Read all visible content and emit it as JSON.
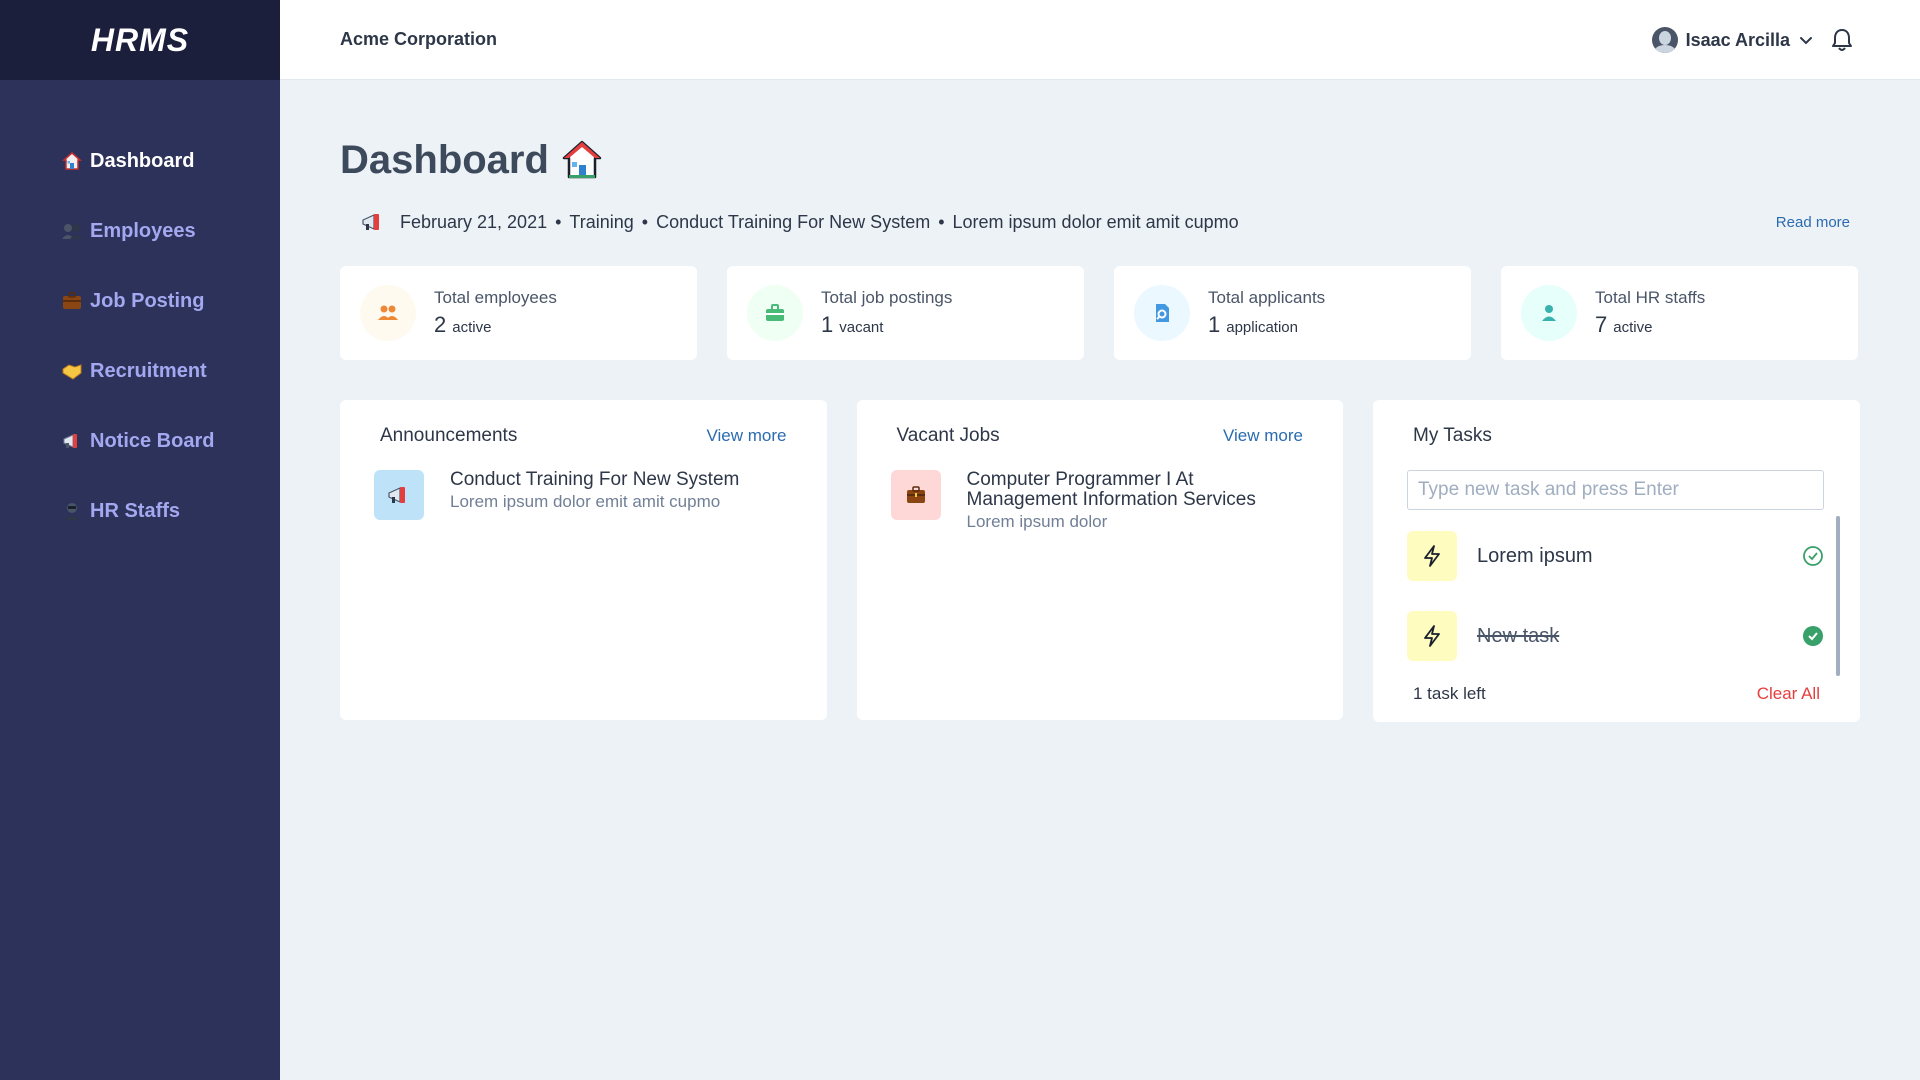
{
  "brand": "HRMS",
  "company": "Acme Corporation",
  "user": {
    "name": "Isaac Arcilla"
  },
  "sidebar": {
    "items": [
      {
        "label": "Dashboard",
        "icon": "house-icon",
        "active": true
      },
      {
        "label": "Employees",
        "icon": "people-icon"
      },
      {
        "label": "Job Posting",
        "icon": "briefcase-icon"
      },
      {
        "label": "Recruitment",
        "icon": "handshake-icon"
      },
      {
        "label": "Notice Board",
        "icon": "megaphone-icon"
      },
      {
        "label": "HR Staffs",
        "icon": "person-icon"
      }
    ]
  },
  "page": {
    "title": "Dashboard"
  },
  "ticker": {
    "date": "February 21, 2021",
    "category": "Training",
    "title": "Conduct Training For New System",
    "summary": "Lorem ipsum dolor emit amit cupmo",
    "read_more": "Read more"
  },
  "stats": [
    {
      "title": "Total employees",
      "value": "2",
      "unit": "active",
      "icon": "users-icon",
      "color": "#ed8936"
    },
    {
      "title": "Total job postings",
      "value": "1",
      "unit": "vacant",
      "icon": "briefcase-icon",
      "color": "#48bb78"
    },
    {
      "title": "Total applicants",
      "value": "1",
      "unit": "application",
      "icon": "file-search-icon",
      "color": "#4299e1"
    },
    {
      "title": "Total HR staffs",
      "value": "7",
      "unit": "active",
      "icon": "user-icon",
      "color": "#38b2ac"
    }
  ],
  "announcements": {
    "title": "Announcements",
    "view_more": "View more",
    "items": [
      {
        "title": "Conduct Training For New System",
        "subtitle": "Lorem ipsum dolor emit amit cupmo"
      }
    ]
  },
  "vacant_jobs": {
    "title": "Vacant Jobs",
    "view_more": "View more",
    "items": [
      {
        "title_line1": "Computer Programmer I At",
        "title_line2": "Management Information Services",
        "subtitle": "Lorem ipsum dolor"
      }
    ]
  },
  "tasks": {
    "title": "My Tasks",
    "input_placeholder": "Type new task and press Enter",
    "items": [
      {
        "label": "Lorem ipsum",
        "done": false
      },
      {
        "label": "New task",
        "done": true
      }
    ],
    "footer_left": "1 task left",
    "clear_all": "Clear All"
  }
}
